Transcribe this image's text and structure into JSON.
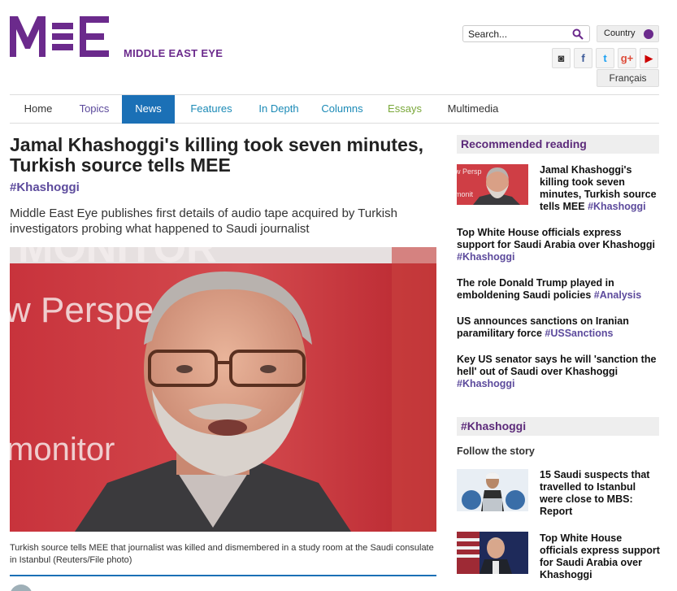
{
  "site": {
    "name": "MIDDLE EAST EYE",
    "logo_text": "MEE",
    "brand_color": "#6b2a8c"
  },
  "header": {
    "search_placeholder": "Search...",
    "country_label": "Country",
    "language_label": "Français",
    "social": [
      {
        "name": "instagram-icon",
        "glyph": "◙",
        "color": "#333333"
      },
      {
        "name": "facebook-icon",
        "glyph": "f",
        "color": "#3b5998"
      },
      {
        "name": "twitter-icon",
        "glyph": "t",
        "color": "#1da1f2"
      },
      {
        "name": "google-plus-icon",
        "glyph": "g+",
        "color": "#dd4b39"
      },
      {
        "name": "youtube-icon",
        "glyph": "▶",
        "color": "#cc0000"
      }
    ]
  },
  "nav": {
    "active_color": "#1b70b6",
    "items": [
      {
        "label": "Home",
        "color": "#333333"
      },
      {
        "label": "Topics",
        "color": "#5c4a9c"
      },
      {
        "label": "News",
        "color": "#ffffff"
      },
      {
        "label": "Features",
        "color": "#1b8ab6"
      },
      {
        "label": "In Depth",
        "color": "#1b8ab6"
      },
      {
        "label": "Columns",
        "color": "#1b8ab6"
      },
      {
        "label": "Essays",
        "color": "#7aa83a"
      },
      {
        "label": "Multimedia",
        "color": "#333333"
      }
    ]
  },
  "article": {
    "headline": "Jamal Khashoggi's killing took seven minutes, Turkish source tells MEE",
    "tag": "#Khashoggi",
    "standfirst": "Middle East Eye publishes first details of audio tape acquired by Turkish investigators probing what happened to Saudi journalist",
    "caption": "Turkish source tells MEE that journalist was killed and dismembered in a study room at the Saudi consulate in Istanbul (Reuters/File photo)",
    "image_banner_text_1": "MONITOR",
    "image_banner_text_2": "w Perspec",
    "image_banner_text_3": "monitor"
  },
  "sidebar": {
    "recommended_heading": "Recommended reading",
    "recommended": [
      {
        "title": "Jamal Khashoggi's killing took seven minutes, Turkish source tells MEE",
        "tag": "#Khashoggi"
      },
      {
        "title": "Top White House officials express support for Saudi Arabia over Khashoggi",
        "tag": "#Khashoggi"
      },
      {
        "title": "The role Donald Trump played in emboldening Saudi policies",
        "tag": "#Analysis"
      },
      {
        "title": "US announces sanctions on Iranian paramilitary force",
        "tag": "#USSanctions"
      },
      {
        "title": "Key US senator says he will 'sanction the hell' out of Saudi over Khashoggi",
        "tag": "#Khashoggi"
      }
    ],
    "topic_heading": "#Khashoggi",
    "follow_label": "Follow the story",
    "story_items": [
      {
        "title": "15 Saudi suspects that travelled to Istanbul were close to MBS: Report"
      },
      {
        "title": "Top White House officials express support for Saudi Arabia over Khashoggi"
      }
    ]
  }
}
